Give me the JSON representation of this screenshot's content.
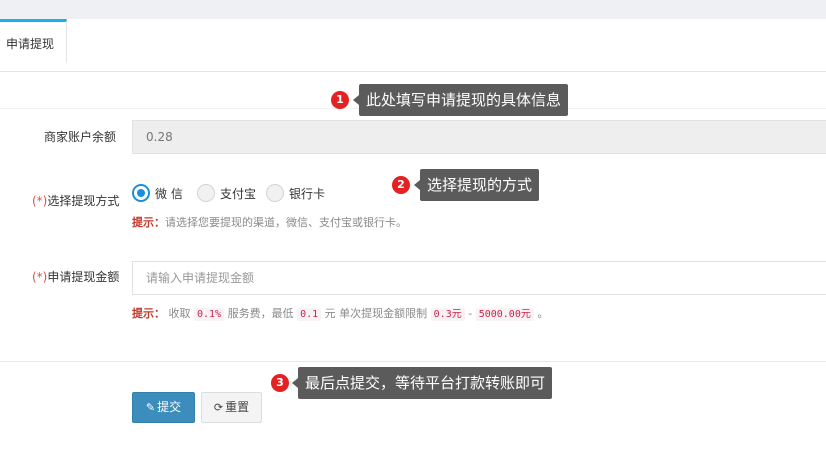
{
  "tabs": [
    {
      "label": "申请提现"
    }
  ],
  "form": {
    "balance": {
      "label": "商家账户余额",
      "value": "0.28"
    },
    "method": {
      "required_mark": "(*)",
      "label": "选择提现方式",
      "options": [
        {
          "label": "微 信",
          "selected": true
        },
        {
          "label": "支付宝",
          "selected": false
        },
        {
          "label": "银行卡",
          "selected": false
        }
      ],
      "hint_prefix": "提示：",
      "hint_text": "请选择您要提现的渠道，微信、支付宝或银行卡。"
    },
    "amount": {
      "required_mark": "(*)",
      "label": "申请提现金额",
      "placeholder": "请输入申请提现金额",
      "hint_prefix": "提示：",
      "hint_parts": [
        "收取",
        "0.1%",
        "服务费，最低",
        "0.1",
        "元 单次提现金额限制",
        "0.3元",
        "-",
        "5000.00元",
        "。"
      ]
    },
    "buttons": {
      "submit": "提交",
      "reset": "重置"
    }
  },
  "annotations": [
    {
      "number": "1",
      "text": "此处填写申请提现的具体信息"
    },
    {
      "number": "2",
      "text": "选择提现的方式"
    },
    {
      "number": "3",
      "text": "最后点提交，等待平台打款转账即可"
    }
  ],
  "colors": {
    "primary": "#3c8dbc",
    "radio_selected": "#1a8fe0",
    "required": "#d9534f",
    "badge": "#e52222",
    "tab_accent": "#1ab0e8"
  }
}
